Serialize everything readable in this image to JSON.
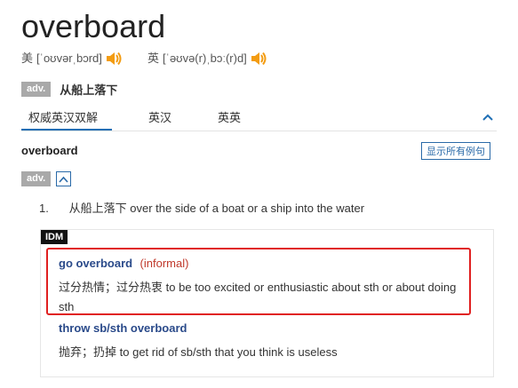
{
  "headword": "overboard",
  "pronunciations": {
    "us": {
      "label": "美",
      "ipa": "[ˈoʊvərˌbɔrd]"
    },
    "uk": {
      "label": "英",
      "ipa": "[ˈəʊvə(r)ˌbɔː(r)d]"
    }
  },
  "summary": {
    "pos": "adv.",
    "meaning": "从船上落下"
  },
  "tabs": [
    {
      "label": "权威英汉双解",
      "active": true
    },
    {
      "label": "英汉"
    },
    {
      "label": "英英"
    }
  ],
  "entry": {
    "word": "overboard",
    "show_examples_label": "显示所有例句",
    "pos": "adv.",
    "senses": [
      {
        "number": "1.",
        "cn": "从船上落下",
        "en": "over the side of a boat or a ship into the water"
      }
    ],
    "idm_label": "IDM",
    "idioms": [
      {
        "phrase": "go overboard",
        "register": "(informal)",
        "cn": "过分热情；过分热衷",
        "en": "to be too excited or enthusiastic about sth or about doing sth"
      },
      {
        "phrase": "throw sb/sth overboard",
        "cn": "抛弃；扔掉",
        "en": "to get rid of sb/sth that you think is useless"
      }
    ]
  },
  "colors": {
    "accent": "#1f6fb5",
    "idiom_title": "#2a4a8a",
    "register": "#c0392b",
    "highlight": "#e02020",
    "speaker": "#f39c12",
    "badge_gray": "#a9a9a9"
  },
  "icons": [
    "speaker-icon",
    "chevron-up-icon"
  ]
}
